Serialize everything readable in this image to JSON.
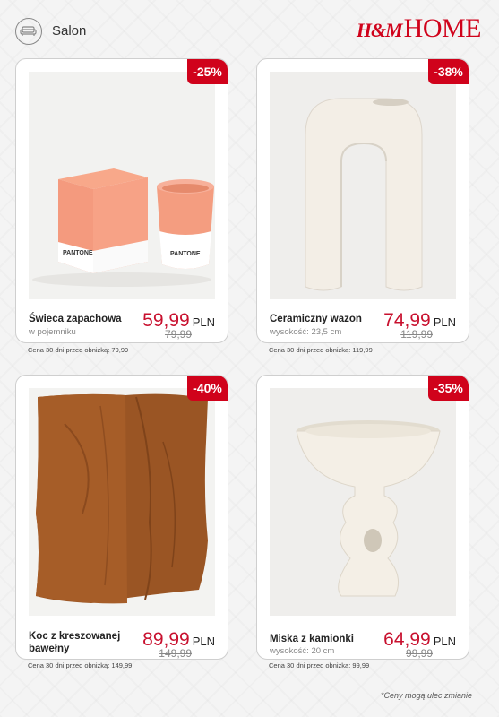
{
  "header": {
    "section_icon": "sofa-icon",
    "section_title": "Salon",
    "brand_hm": "H&M",
    "brand_home": "HOME",
    "brand_color": "#d0021b"
  },
  "products": [
    {
      "name": "Świeca zapachowa",
      "sub": "w pojemniku",
      "price": "59,99",
      "currency": "PLN",
      "old_price": "79,99",
      "note": "Cena 30 dni przed obniżką: 79,99",
      "discount": "-25%",
      "box_label": "PANTONE",
      "cup_label": "PANTONE"
    },
    {
      "name": "Ceramiczny wazon",
      "sub": "wysokość: 23,5 cm",
      "price": "74,99",
      "currency": "PLN",
      "old_price": "119,99",
      "note": "Cena 30 dni przed obniżką: 119,99",
      "discount": "-38%"
    },
    {
      "name": "Koc z kreszowanej bawełny",
      "sub": "",
      "price": "89,99",
      "currency": "PLN",
      "old_price": "149,99",
      "note": "Cena 30 dni przed obniżką: 149,99",
      "discount": "-40%"
    },
    {
      "name": "Miska z kamionki",
      "sub": "wysokość: 20 cm",
      "price": "64,99",
      "currency": "PLN",
      "old_price": "99,99",
      "note": "Cena 30 dni przed obniżką: 99,99",
      "discount": "-35%"
    }
  ],
  "footnote": "*Ceny mogą ulec zmianie"
}
